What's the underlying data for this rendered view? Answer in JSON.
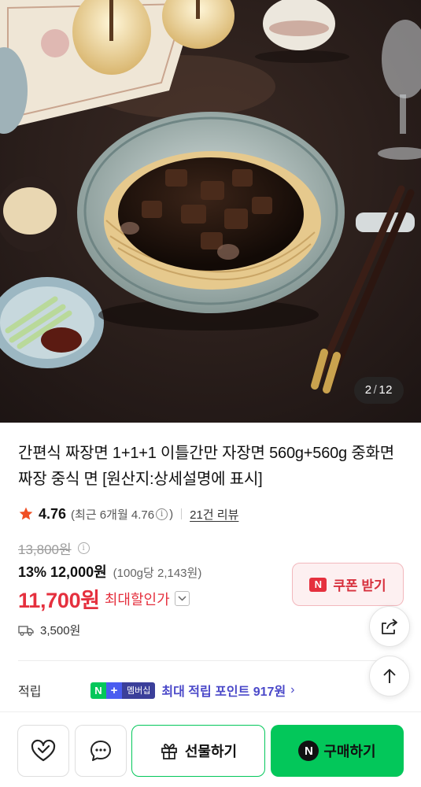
{
  "gallery": {
    "current": "2",
    "separator": "/",
    "total": "12"
  },
  "product": {
    "title": "간편식 짜장면 1+1+1 이틀간만 자장면 560g+560g 중화면 짜장 중식 면 [원산지:상세설명에 표시]"
  },
  "rating": {
    "score": "4.76",
    "recent_label": "(최근 6개월 4.76",
    "recent_close": ")",
    "info_icon": "info-circle-icon",
    "review_count": "21건 리뷰",
    "star_color": "#f04e23"
  },
  "price": {
    "original": "13,800원",
    "discount_rate": "13%",
    "sale_price": "12,000원",
    "unit_price": "(100g당 2,143원)",
    "max_discount_price": "11,700원",
    "max_discount_label": "최대할인가",
    "accent_color": "#e5303e"
  },
  "coupon": {
    "badge": "N",
    "label": "쿠폰 받기"
  },
  "shipping": {
    "icon": "truck-icon",
    "fee": "3,500원"
  },
  "points": {
    "label": "적립",
    "badge_n": "N",
    "badge_plus": "+",
    "badge_member": "멤버십",
    "text": "최대 적립 포인트 917원",
    "chevron": "›"
  },
  "floating": {
    "share_icon": "share-icon",
    "top_icon": "arrow-up-icon"
  },
  "bottom_bar": {
    "like_icon": "heart-check-icon",
    "talk_icon": "chat-bubble-icon",
    "gift_label": "선물하기",
    "buy_badge": "N",
    "buy_label": "구매하기",
    "buy_color": "#03c75a"
  }
}
